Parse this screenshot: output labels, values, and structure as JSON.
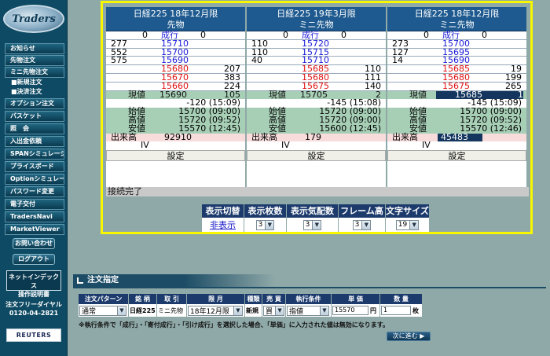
{
  "sidebar": {
    "logo": "Traders",
    "items": [
      {
        "label": "お知らせ"
      },
      {
        "label": "先物注文"
      },
      {
        "label": "ミニ先物注文"
      },
      {
        "label": "オプション注文"
      },
      {
        "label": "バスケット"
      },
      {
        "label": "照　会"
      },
      {
        "label": "入出金依頼"
      },
      {
        "label": "SPANシミュレーション"
      },
      {
        "label": "プライスボード"
      },
      {
        "label": "Optionシミュレーター"
      },
      {
        "label": "パスワード変更"
      },
      {
        "label": "電子交付"
      },
      {
        "label": "TradersNavi"
      },
      {
        "label": "MarketViewer"
      }
    ],
    "subitems": [
      "■新規注文",
      "■決済注文"
    ],
    "contact": "お問い合わせ",
    "logout": "ログアウト",
    "manual_line1": "ネットインデックス",
    "manual_line2": "操作説明書",
    "dial_line1": "注文フリーダイヤル",
    "dial_line2": "0120-04-2821",
    "reuters": "REUTERS"
  },
  "boards": [
    {
      "title": "日経225 18年12月限",
      "subtitle": "先物",
      "top": {
        "left": "0",
        "mid": "成行",
        "right": "0"
      },
      "asks": [
        [
          "277",
          "15710"
        ],
        [
          "552",
          "15700"
        ],
        [
          "575",
          "15690"
        ]
      ],
      "bids": [
        [
          "15680",
          "207"
        ],
        [
          "15670",
          "383"
        ],
        [
          "15660",
          "224"
        ]
      ],
      "current": {
        "label": "現値",
        "price": "15690",
        "vol": "105"
      },
      "change": "-120 (15:09)",
      "open": {
        "label": "始値",
        "value": "15700 (09:00)"
      },
      "high": {
        "label": "高値",
        "value": "15720 (09:52)"
      },
      "low": {
        "label": "安値",
        "value": "15570 (12:45)"
      },
      "volume": {
        "label": "出来高",
        "value": "92910"
      },
      "iv": "IV",
      "setting": "設定"
    },
    {
      "title": "日経225 19年3月限",
      "subtitle": "ミニ先物",
      "top": {
        "left": "0",
        "mid": "成行",
        "right": "0"
      },
      "asks": [
        [
          "110",
          "15720"
        ],
        [
          "110",
          "15715"
        ],
        [
          "40",
          "15710"
        ]
      ],
      "bids": [
        [
          "15685",
          "110"
        ],
        [
          "15680",
          "111"
        ],
        [
          "15675",
          "140"
        ]
      ],
      "current": {
        "label": "現値",
        "price": "15705",
        "vol": "2"
      },
      "change": "-145 (15:08)",
      "open": {
        "label": "始値",
        "value": "15720 (09:00)"
      },
      "high": {
        "label": "高値",
        "value": "15720 (09:00)"
      },
      "low": {
        "label": "安値",
        "value": "15600 (12:45)"
      },
      "volume": {
        "label": "出来高",
        "value": "179"
      },
      "iv": "IV",
      "setting": "設定"
    },
    {
      "title": "日経225 18年12月限",
      "subtitle": "ミニ先物",
      "top": {
        "left": "0",
        "mid": "成行",
        "right": "0"
      },
      "asks": [
        [
          "273",
          "15700"
        ],
        [
          "127",
          "15695"
        ],
        [
          "14",
          "15690"
        ]
      ],
      "bids": [
        [
          "15685",
          "19"
        ],
        [
          "15680",
          "199"
        ],
        [
          "15675",
          "265"
        ]
      ],
      "current": {
        "label": "現値",
        "price": "15685",
        "vol": "1"
      },
      "change": "-145 (15:09)",
      "open": {
        "label": "始値",
        "value": "15700 (09:00)"
      },
      "high": {
        "label": "高値",
        "value": "15720 (09:52)"
      },
      "low": {
        "label": "安値",
        "value": "15570 (12:46)"
      },
      "volume": {
        "label": "出来高",
        "value": "45483"
      },
      "iv": "IV",
      "setting": "設定"
    }
  ],
  "status": "接続完了",
  "controls": {
    "headers": [
      "表示切替",
      "表示枚数",
      "表示気配数",
      "フレーム高",
      "文字サイズ"
    ],
    "hide_link": "非表示",
    "values": [
      "3",
      "3",
      "3",
      "19"
    ]
  },
  "order": {
    "title": "注文指定",
    "headers": [
      "注文パターン",
      "銘 柄",
      "取 引",
      "限 月",
      "種類",
      "売 買",
      "執行条件",
      "単 価",
      "数 量"
    ],
    "pattern": "通常",
    "symbol": "日経225",
    "trade": "ミニ先物",
    "month": "18年12月限",
    "kind": "新規",
    "side": "買",
    "condition": "指値",
    "price": "15570",
    "price_unit": "円",
    "qty": "1",
    "qty_unit": "枚",
    "note": "※執行条件で「成行」・「寄付成行」・「引け成行」を選択した場合、「単価」に入力された値は無効になります。",
    "next_button": "次に進む"
  },
  "colors": {
    "accent": "#1e5a8f",
    "frame": "#f7f700",
    "background": "#8fa9a8",
    "sidebar": "#0e4a63"
  }
}
